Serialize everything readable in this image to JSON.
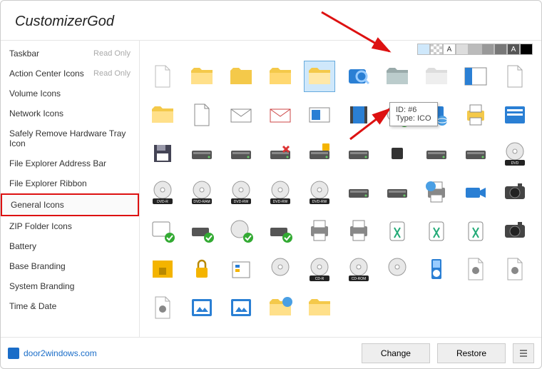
{
  "app": {
    "title": "CustomizerGod"
  },
  "sidebar": {
    "items": [
      {
        "label": "Taskbar",
        "readonly": "Read Only"
      },
      {
        "label": "Action Center Icons",
        "readonly": "Read Only"
      },
      {
        "label": "Volume Icons"
      },
      {
        "label": "Network Icons"
      },
      {
        "label": "Safely Remove Hardware Tray Icon"
      },
      {
        "label": "File Explorer Address Bar"
      },
      {
        "label": "File Explorer Ribbon"
      },
      {
        "label": "General Icons",
        "selected": true
      },
      {
        "label": "ZIP Folder Icons"
      },
      {
        "label": "Battery"
      },
      {
        "label": "Base Branding"
      },
      {
        "label": "System Branding"
      },
      {
        "label": "Time & Date"
      }
    ]
  },
  "tooltip": {
    "id_label": "ID: #6",
    "type_label": "Type: ICO"
  },
  "bg_swatches": [
    {
      "bg": "#cfe8fb",
      "txt": ""
    },
    {
      "bg": "repeating-conic-gradient(#ccc 0 25%, #fff 0 50%) 0/8px 8px",
      "txt": ""
    },
    {
      "bg": "#fff",
      "txt": "A"
    },
    {
      "bg": "#ddd",
      "txt": ""
    },
    {
      "bg": "#bbb",
      "txt": ""
    },
    {
      "bg": "#999",
      "txt": ""
    },
    {
      "bg": "#777",
      "txt": ""
    },
    {
      "bg": "#555",
      "txt": "A"
    },
    {
      "bg": "#000",
      "txt": ""
    }
  ],
  "icons": [
    {
      "name": "blank-document-icon"
    },
    {
      "name": "folder-open-icon"
    },
    {
      "name": "folder-icon"
    },
    {
      "name": "folder-alt-icon"
    },
    {
      "name": "folder-selected-icon",
      "selected": true
    },
    {
      "name": "search-folder-icon"
    },
    {
      "name": "folder-gray-icon"
    },
    {
      "name": "folder-empty-icon"
    },
    {
      "name": "explorer-panel-icon"
    },
    {
      "name": "paper-icon"
    },
    {
      "name": "folder2-icon"
    },
    {
      "name": "document-icon"
    },
    {
      "name": "mail-icon"
    },
    {
      "name": "envelope-icon"
    },
    {
      "name": "image-slide-icon"
    },
    {
      "name": "film-icon"
    },
    {
      "name": "disc-check-icon"
    },
    {
      "name": "monitor-globe-icon"
    },
    {
      "name": "printer-icon"
    },
    {
      "name": "settings-panel-icon"
    },
    {
      "name": "drive-floppy-icon"
    },
    {
      "name": "drive-icon"
    },
    {
      "name": "drive2-icon"
    },
    {
      "name": "drive-remove-icon"
    },
    {
      "name": "drive-lock-icon"
    },
    {
      "name": "drive-dark-icon"
    },
    {
      "name": "drive-small-icon"
    },
    {
      "name": "hdd-icon"
    },
    {
      "name": "hdd2-icon"
    },
    {
      "name": "disc-dvd-icon"
    },
    {
      "name": "disc-dvdr-icon"
    },
    {
      "name": "disc-dvdram-icon"
    },
    {
      "name": "disc-dvdrw-icon"
    },
    {
      "name": "disc-dvdrw2-icon"
    },
    {
      "name": "disc-dvdrw3-icon"
    },
    {
      "name": "hdd-gray-icon"
    },
    {
      "name": "hdd-slim-icon"
    },
    {
      "name": "printer-globe-icon"
    },
    {
      "name": "camcorder-icon"
    },
    {
      "name": "camera2-icon"
    },
    {
      "name": "app-check-icon"
    },
    {
      "name": "hdd-check-icon"
    },
    {
      "name": "disc-check2-icon"
    },
    {
      "name": "drive-check-icon"
    },
    {
      "name": "printer-net-icon"
    },
    {
      "name": "printer2-icon"
    },
    {
      "name": "recycle-alt-icon"
    },
    {
      "name": "recycle-icon"
    },
    {
      "name": "recycle2-icon"
    },
    {
      "name": "camera-icon"
    },
    {
      "name": "padlock-bg-icon"
    },
    {
      "name": "padlock-icon"
    },
    {
      "name": "inventory-icon"
    },
    {
      "name": "disc-icon"
    },
    {
      "name": "disc-cdr-icon"
    },
    {
      "name": "disc-cdrom-icon"
    },
    {
      "name": "disc-cd-icon"
    },
    {
      "name": "music-player-icon"
    },
    {
      "name": "gear-doc-icon"
    },
    {
      "name": "gear-doc2-icon"
    },
    {
      "name": "gear-doc3-icon"
    },
    {
      "name": "photo-icon"
    },
    {
      "name": "photo2-icon"
    },
    {
      "name": "folder-globe-icon"
    },
    {
      "name": "folder-net-icon"
    }
  ],
  "footer": {
    "link": "door2windows.com",
    "change": "Change",
    "restore": "Restore"
  }
}
